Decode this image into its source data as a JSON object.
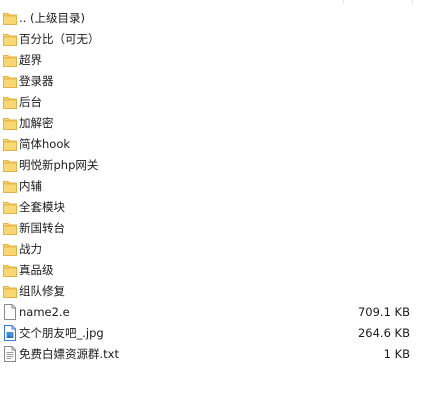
{
  "file_list": {
    "folders": [
      {
        "name": ".. (上级目录)",
        "icon": "folder-icon"
      },
      {
        "name": "百分比（可无）",
        "icon": "folder-icon"
      },
      {
        "name": "超界",
        "icon": "folder-icon"
      },
      {
        "name": "登录器",
        "icon": "folder-icon"
      },
      {
        "name": "后台",
        "icon": "folder-icon"
      },
      {
        "name": "加解密",
        "icon": "folder-icon"
      },
      {
        "name": "简体hook",
        "icon": "folder-icon"
      },
      {
        "name": "明悦新php网关",
        "icon": "folder-icon"
      },
      {
        "name": "内辅",
        "icon": "folder-icon"
      },
      {
        "name": "全套模块",
        "icon": "folder-icon"
      },
      {
        "name": "新国转台",
        "icon": "folder-icon"
      },
      {
        "name": "战力",
        "icon": "folder-icon"
      },
      {
        "name": "真品级",
        "icon": "folder-icon"
      },
      {
        "name": "组队修复",
        "icon": "folder-icon"
      }
    ],
    "files": [
      {
        "name": "name2.e",
        "size": "709.1 KB",
        "icon": "generic-file-icon"
      },
      {
        "name": "交个朋友吧_.jpg",
        "size": "264.6 KB",
        "icon": "image-file-icon"
      },
      {
        "name": "免费白嫖资源群.txt",
        "size": "1 KB",
        "icon": "text-file-icon"
      }
    ]
  },
  "colors": {
    "folder_fill": "#f8d775",
    "folder_tab": "#e9b94a",
    "text": "#1a1a1a"
  }
}
